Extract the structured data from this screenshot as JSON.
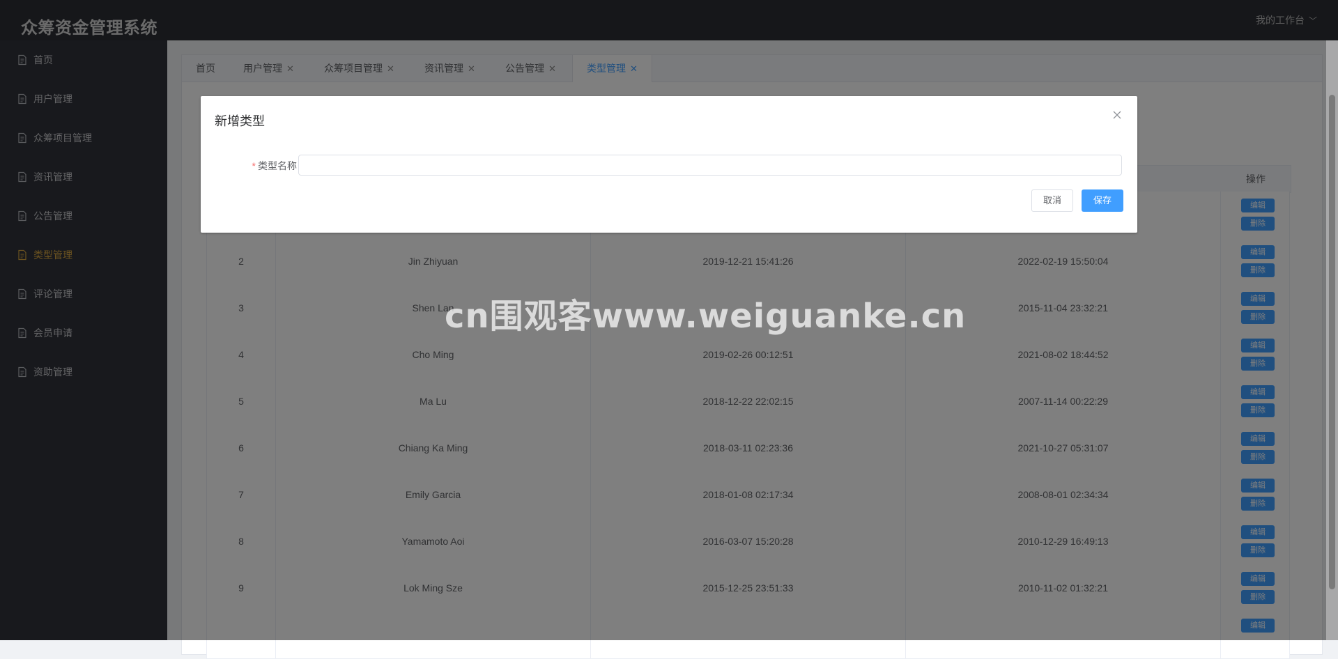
{
  "header": {
    "brand": "众筹资金管理系统",
    "workbench": "我的工作台"
  },
  "sidebar": {
    "items": [
      {
        "label": "首页"
      },
      {
        "label": "用户管理"
      },
      {
        "label": "众筹项目管理"
      },
      {
        "label": "资讯管理"
      },
      {
        "label": "公告管理"
      },
      {
        "label": "类型管理",
        "active": true
      },
      {
        "label": "评论管理"
      },
      {
        "label": "会员申请"
      },
      {
        "label": "资助管理"
      }
    ]
  },
  "tabs": [
    {
      "label": "首页"
    },
    {
      "label": "用户管理"
    },
    {
      "label": "众筹项目管理"
    },
    {
      "label": "资讯管理"
    },
    {
      "label": "公告管理"
    },
    {
      "label": "类型管理",
      "active": true
    }
  ],
  "table": {
    "ops_header": "操作",
    "edit_label": "编辑",
    "delete_label": "删除",
    "rows": [
      {
        "no": "2",
        "name": "Jin Zhiyuan",
        "created": "2019-12-21 15:41:26",
        "updated": "2022-02-19 15:50:04"
      },
      {
        "no": "3",
        "name": "Shen Lan",
        "created": "",
        "updated": "2015-11-04 23:32:21"
      },
      {
        "no": "4",
        "name": "Cho Ming",
        "created": "2019-02-26 00:12:51",
        "updated": "2021-08-02 18:44:52"
      },
      {
        "no": "5",
        "name": "Ma Lu",
        "created": "2018-12-22 22:02:15",
        "updated": "2007-11-14 00:22:29"
      },
      {
        "no": "6",
        "name": "Chiang Ka Ming",
        "created": "2018-03-11 02:23:36",
        "updated": "2021-10-27 05:31:07"
      },
      {
        "no": "7",
        "name": "Emily Garcia",
        "created": "2018-01-08 02:17:34",
        "updated": "2008-08-01 02:34:34"
      },
      {
        "no": "8",
        "name": "Yamamoto Aoi",
        "created": "2016-03-07 15:20:28",
        "updated": "2010-12-29 16:49:13"
      },
      {
        "no": "9",
        "name": "Lok Ming Sze",
        "created": "2015-12-25 23:51:33",
        "updated": "2010-11-02 01:32:21"
      }
    ]
  },
  "dialog": {
    "title": "新增类型",
    "field_label": "类型名称",
    "field_value": "",
    "cancel_label": "取消",
    "save_label": "保存"
  },
  "watermark": "cn围观客www.weiguanke.cn",
  "colors": {
    "accent": "#409eff",
    "sidebar_bg": "#30333a",
    "active_menu": "#d9a640"
  }
}
